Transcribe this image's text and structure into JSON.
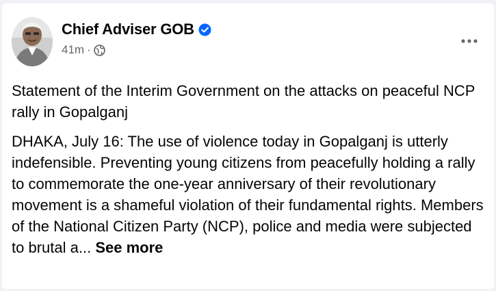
{
  "post": {
    "author": "Chief Adviser GOB",
    "time": "41m",
    "separator": "·",
    "verified_icon": "verified-badge-icon",
    "audience_icon": "globe-icon",
    "more_icon": "more-options-icon",
    "title": "Statement of the Interim Government on the attacks on peaceful NCP rally in Gopalganj",
    "body": "DHAKA, July 16: The use of violence today in Gopalganj is utterly indefensible. Preventing young citizens from peacefully holding a rally to commemorate the one-year anniversary of their revolutionary movement is a shameful violation of their fundamental rights. Members of the National Citizen Party (NCP), police and media were subjected to brutal a...",
    "see_more": "See more"
  },
  "colors": {
    "verified_blue": "#0866ff",
    "secondary_text": "#65676b",
    "primary_text": "#050505"
  }
}
